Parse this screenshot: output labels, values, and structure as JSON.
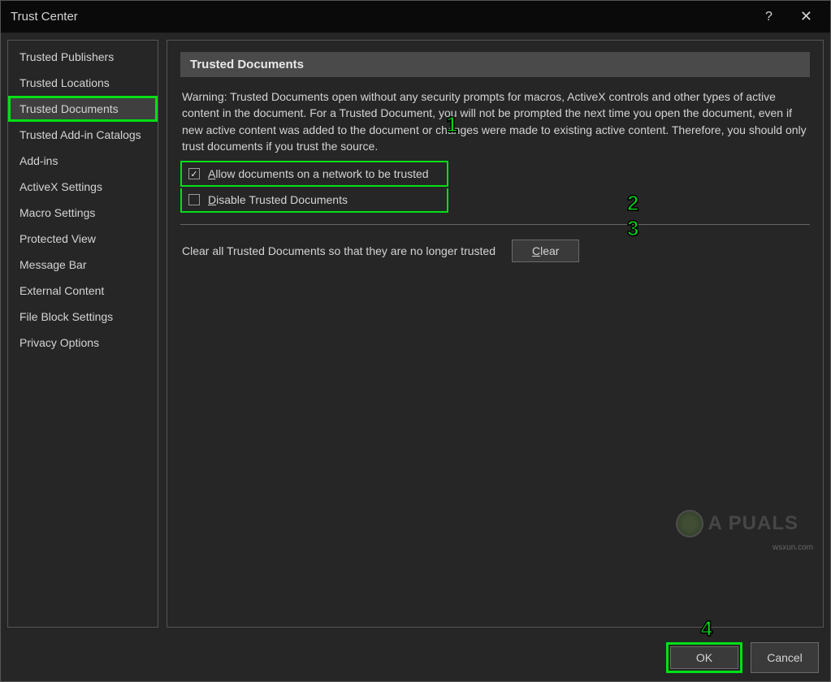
{
  "titlebar": {
    "title": "Trust Center",
    "help": "?",
    "close": "✕"
  },
  "sidebar": {
    "items": [
      {
        "label": "Trusted Publishers"
      },
      {
        "label": "Trusted Locations"
      },
      {
        "label": "Trusted Documents"
      },
      {
        "label": "Trusted Add-in Catalogs"
      },
      {
        "label": "Add-ins"
      },
      {
        "label": "ActiveX Settings"
      },
      {
        "label": "Macro Settings"
      },
      {
        "label": "Protected View"
      },
      {
        "label": "Message Bar"
      },
      {
        "label": "External Content"
      },
      {
        "label": "File Block Settings"
      },
      {
        "label": "Privacy Options"
      }
    ],
    "selected_index": 2
  },
  "main": {
    "section_title": "Trusted Documents",
    "warning": "Warning: Trusted Documents open without any security prompts for macros, ActiveX controls and other types of active content in the document.  For a Trusted Document, you will not be prompted the next time you open the document, even if new active content was added to the document or changes were made to existing active content. Therefore, you should only trust documents if you trust the source.",
    "checkbox1": {
      "checked": true,
      "prefix": "A",
      "rest": "llow documents on a network to be trusted"
    },
    "checkbox2": {
      "checked": false,
      "prefix": "D",
      "rest": "isable Trusted Documents"
    },
    "clear_text": "Clear all Trusted Documents so that they are no longer trusted",
    "clear_button": {
      "prefix": "C",
      "rest": "lear"
    }
  },
  "footer": {
    "ok": "OK",
    "cancel": "Cancel"
  },
  "annotations": {
    "n1": "1",
    "n2": "2",
    "n3": "3",
    "n4": "4"
  },
  "watermark": {
    "text": "A  PUALS",
    "corner": "wsxun.com"
  }
}
